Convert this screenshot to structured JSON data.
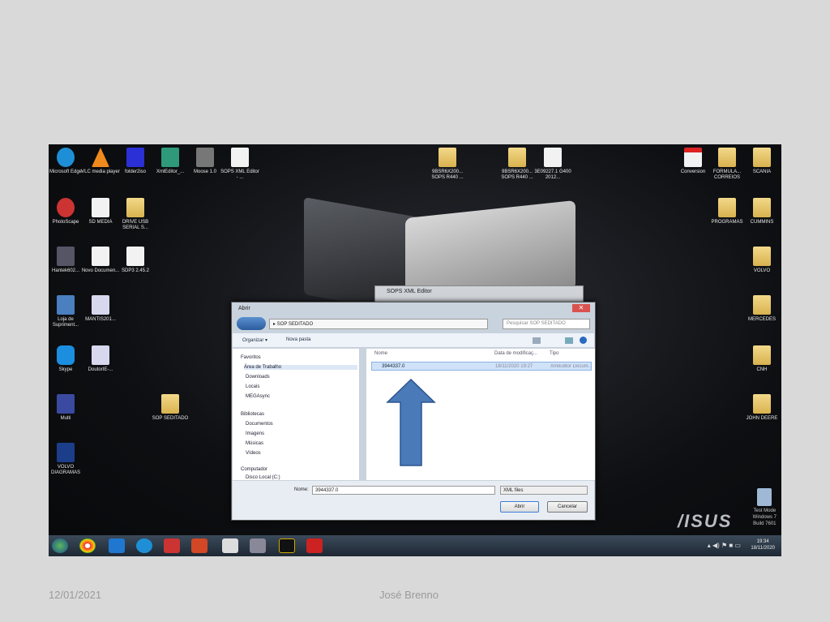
{
  "desktop_icons": [
    "Microsoft Edge",
    "VLC media player",
    "folder2iso",
    "XmlEditor_...",
    "Moose 1.0",
    "SOPS XML Editor - ...",
    "PhotoScape",
    "SD MEDIA",
    "DRIVE USB SERIAL S...",
    "Hantek602...",
    "Novo Documen...",
    "SDP3 2.45.2",
    "Loja de Supriment...",
    "MANTIS201...",
    "Skype",
    "DoutorIE-...",
    "Multi",
    "SOP SEDITADO",
    "VOLVO DIAGRAMAS",
    "9BSR6X200... SOPS R440 ...",
    "9BSR6X200... SOPS R440 ...",
    "3E09227.1 G400 2012...",
    "Conversion",
    "FORMULA... CORREIOS",
    "SCANIA",
    "PROGRAMAS",
    "CUMMINS",
    "VOLVO",
    "MERCEDES",
    "CNH",
    "JOHN DEERE"
  ],
  "brand": "/ISUS",
  "watermark": {
    "line1": "Test Mode",
    "line2": "Windows 7",
    "line3": "Build 7601"
  },
  "clock": {
    "time": "19:34",
    "date": "18/11/2020"
  },
  "bg_window": {
    "title": "SOPS XML Editor"
  },
  "dialog": {
    "title": "Abrir",
    "close": "✕",
    "path": "▸ SOP SEDITADO",
    "search_placeholder": "Pesquisar SOP SEDITADO",
    "organize": "Organizar ▾",
    "new_folder": "Nova pasta",
    "sidebar": {
      "favorites": "Favoritos",
      "items1": [
        "Área de Trabalho",
        "Downloads",
        "Locais",
        "MEGAsync"
      ],
      "libraries": "Bibliotecas",
      "items2": [
        "Documentos",
        "Imagens",
        "Músicas",
        "Vídeos"
      ],
      "computer": "Computador",
      "items3": [
        "Disco Local (C:)"
      ]
    },
    "columns": {
      "name": "Nome",
      "date": "Data de modificaç...",
      "type": "Tipo"
    },
    "file": {
      "name": "3944337.0",
      "date": "18/11/2020 19:27",
      "type": "XmlEditor Docum..."
    },
    "name_label": "Nome:",
    "name_value": "3944337.0",
    "filter": "XML files",
    "open": "Abrir",
    "cancel": "Cancelar"
  },
  "footer": {
    "date": "12/01/2021",
    "author": "José Brenno"
  }
}
